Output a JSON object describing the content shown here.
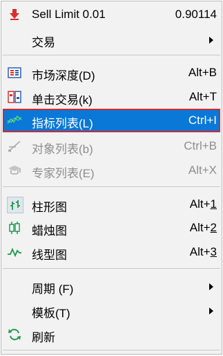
{
  "menu": {
    "sell_limit": {
      "label": "Sell Limit 0.01",
      "value": "0.90114",
      "icon": "sell-down-arrow-icon"
    },
    "trade": {
      "label": "交易",
      "icon": "none"
    },
    "market_depth": {
      "label": "市场深度(D)",
      "shortcut": "Alt+B",
      "icon": "market-depth-icon"
    },
    "one_click": {
      "label": "单击交易(k)",
      "shortcut": "Alt+T",
      "icon": "one-click-trading-icon"
    },
    "indicators": {
      "label": "指标列表(L)",
      "shortcut": "Ctrl+I",
      "icon": "indicator-list-icon"
    },
    "objects": {
      "label": "对象列表(b)",
      "shortcut": "Ctrl+B",
      "icon": "object-list-icon"
    },
    "experts": {
      "label": "专家列表(E)",
      "shortcut": "Alt+X",
      "icon": "expert-list-icon"
    },
    "bar_chart": {
      "label": "柱形图",
      "shortcut_prefix": "Alt+",
      "shortcut_key": "1",
      "icon": "bar-chart-icon"
    },
    "candles": {
      "label": "蜡烛图",
      "shortcut_prefix": "Alt+",
      "shortcut_key": "2",
      "icon": "candlestick-icon"
    },
    "line_chart": {
      "label": "线型图",
      "shortcut_prefix": "Alt+",
      "shortcut_key": "3",
      "icon": "line-chart-icon"
    },
    "period": {
      "label": "周期 (F)"
    },
    "template": {
      "label": "模板(T)"
    },
    "refresh": {
      "label": "刷新",
      "icon": "refresh-icon"
    }
  },
  "colors": {
    "highlight": "#0a78d7",
    "highlight_border": "#d9262c",
    "disabled_text": "#8e8e8e",
    "icon_red": "#d62f2f",
    "icon_green": "#1a9a4a",
    "icon_blue": "#2b5fb3"
  }
}
